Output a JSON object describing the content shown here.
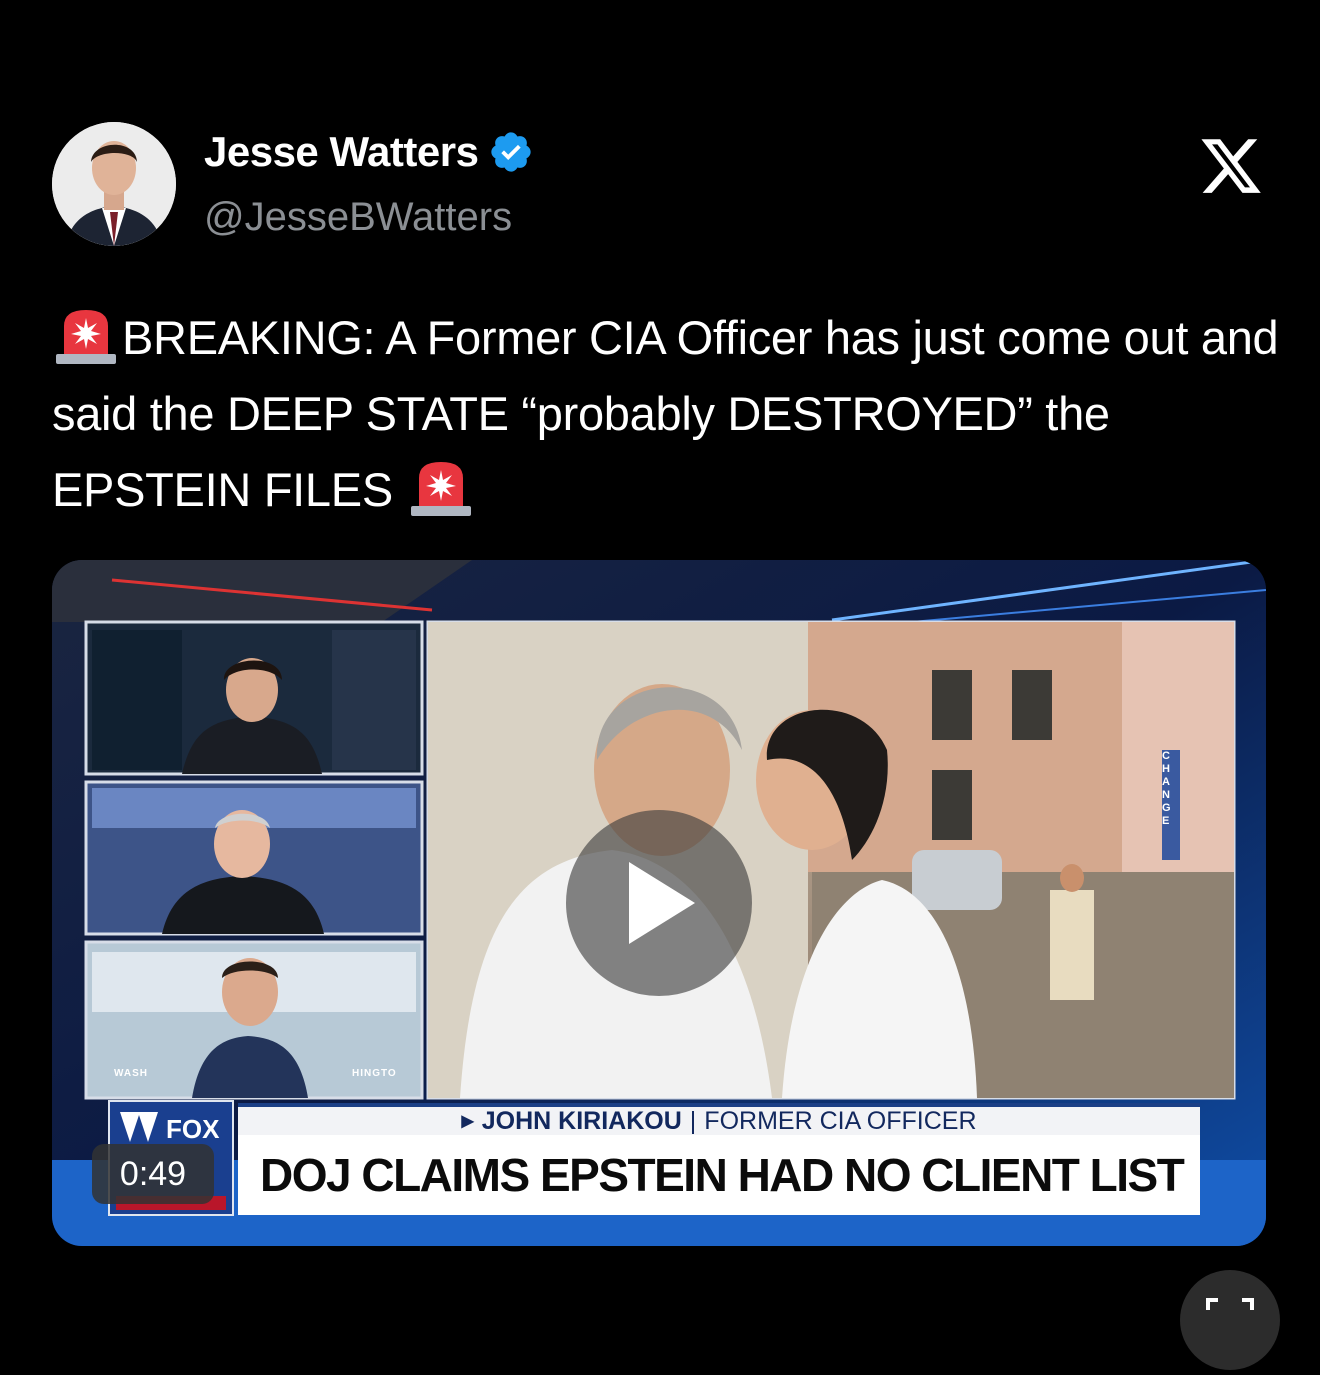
{
  "tweet": {
    "display_name": "Jesse Watters",
    "handle": "@JesseBWatters",
    "verified_icon": "verified-badge-icon",
    "platform_icon": "x-logo-icon",
    "text_main": "BREAKING: A Former CIA Officer has just come out and said the DEEP STATE “probably DESTROYED” the EPSTEIN FILES",
    "emoji": "police-car-light-emoji"
  },
  "video": {
    "duration": "0:49",
    "lower_third_name": "JOHN KIRIAKOU",
    "lower_third_separator": "|",
    "lower_third_title": "FORMER CIA OFFICER",
    "headline": "DOJ CLAIMS EPSTEIN HAD NO CLIENT LIST",
    "panel_label_left": "WASH",
    "panel_label_right": "HINGTO",
    "building_sign": "CHANGE"
  },
  "colors": {
    "background": "#000000",
    "handle_gray": "#8b8f94",
    "verified_blue": "#1d9bf0",
    "fox_navy": "#1b3f86"
  }
}
